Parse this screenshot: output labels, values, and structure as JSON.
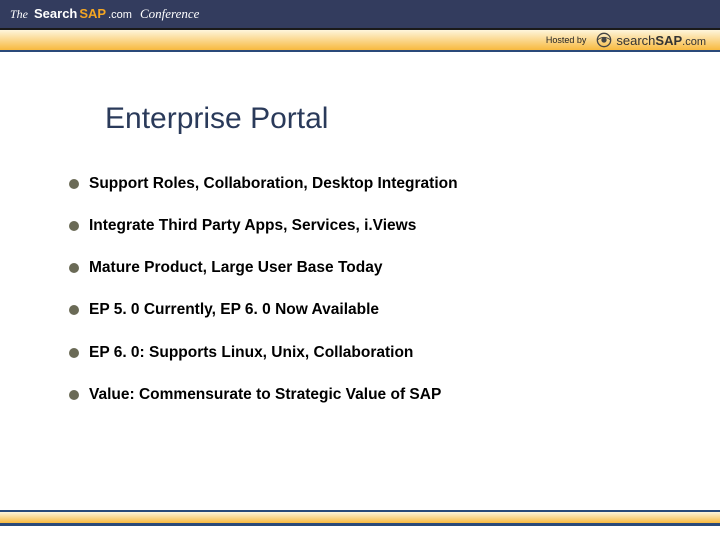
{
  "header": {
    "the": "The",
    "search": "Search",
    "sap": "SAP",
    "com": ".com",
    "conference": "Conference"
  },
  "hosted_by_label": "Hosted by",
  "logo": {
    "search": "search",
    "sap": "SAP",
    "com": ".com"
  },
  "slide": {
    "title": "Enterprise Portal",
    "bullets": [
      "Support Roles, Collaboration, Desktop Integration",
      "Integrate Third Party Apps, Services, i.Views",
      "Mature Product, Large User Base Today",
      "EP 5. 0 Currently, EP 6. 0 Now Available",
      "EP 6. 0: Supports Linux, Unix, Collaboration",
      "Value: Commensurate to Strategic Value of SAP"
    ]
  }
}
